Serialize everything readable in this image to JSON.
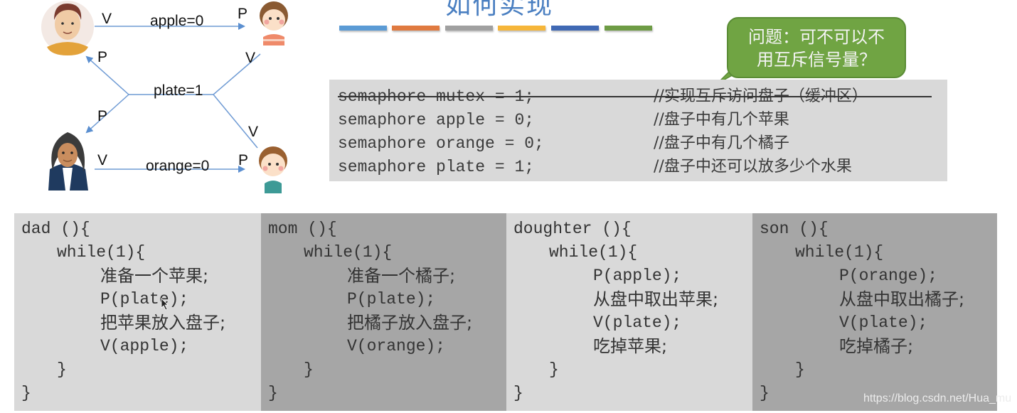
{
  "slide": {
    "title": "如何实现",
    "accent_bars": [
      "#5b9bd5",
      "#ed7d31",
      "#a5a5a5",
      "#ffc000",
      "#4472c4",
      "#70ad47"
    ]
  },
  "diagram": {
    "labels": {
      "apple_edge": "apple=0",
      "plate_edge": "plate=1",
      "orange_edge": "orange=0",
      "dad_v": "V",
      "daughter_p": "P",
      "dad_p": "P",
      "mom_p": "P",
      "daughter_v": "V",
      "son_v": "V",
      "mom_v": "V",
      "son_p": "P"
    },
    "people": [
      "dad",
      "daughter",
      "mom",
      "son"
    ]
  },
  "semaphores": {
    "lines": [
      {
        "code": "semaphore mutex = 1;",
        "comment": "//实现互斥访问盘子（缓冲区）",
        "struck": true
      },
      {
        "code": "semaphore apple = 0;",
        "comment": "//盘子中有几个苹果",
        "struck": false
      },
      {
        "code": "semaphore orange = 0;",
        "comment": "//盘子中有几个橘子",
        "struck": false
      },
      {
        "code": "semaphore plate = 1;",
        "comment": "//盘子中还可以放多少个水果",
        "struck": false
      }
    ]
  },
  "bubble": {
    "line1": "问题：可不可以不",
    "line2": "用互斥信号量？"
  },
  "code_panels": [
    {
      "name": "dad",
      "lines": [
        "dad (){",
        "while(1){",
        "准备一个苹果;",
        "P(plate);",
        "把苹果放入盘子;",
        "V(apple);",
        "}",
        "}"
      ]
    },
    {
      "name": "mom",
      "lines": [
        "mom (){",
        "while(1){",
        "准备一个橘子;",
        "P(plate);",
        "把橘子放入盘子;",
        "V(orange);",
        "}",
        "}"
      ]
    },
    {
      "name": "doughter",
      "lines": [
        "doughter (){",
        "while(1){",
        "P(apple);",
        "从盘中取出苹果;",
        "V(plate);",
        "吃掉苹果;",
        "}",
        "}"
      ]
    },
    {
      "name": "son",
      "lines": [
        "son (){",
        "while(1){",
        "P(orange);",
        "从盘中取出橘子;",
        "V(plate);",
        "吃掉橘子;",
        "}",
        "}"
      ]
    }
  ],
  "watermark": "https://blog.csdn.net/Hua_mu"
}
